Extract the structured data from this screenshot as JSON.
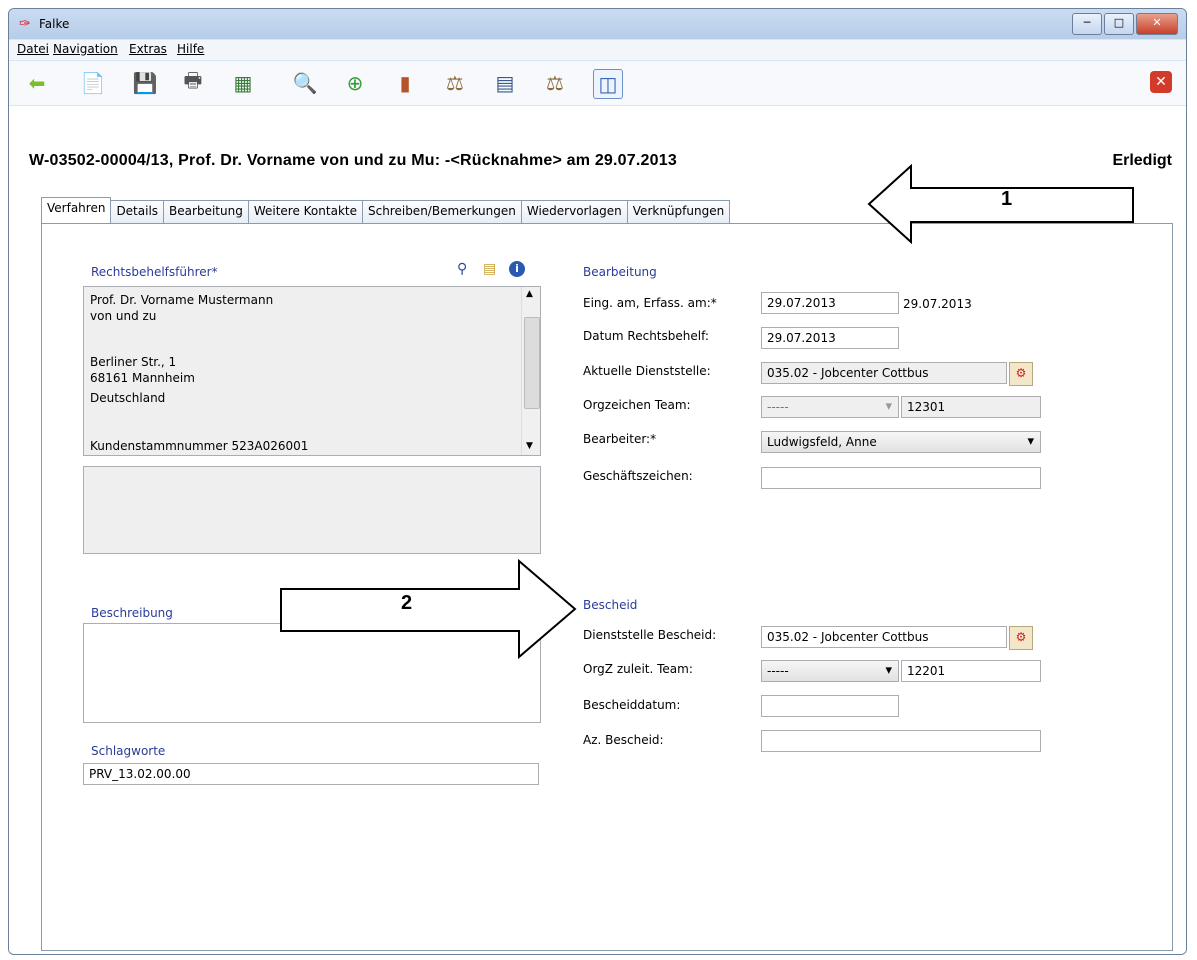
{
  "window": {
    "title": "Falke",
    "controls": [
      "─",
      "□",
      "✕"
    ]
  },
  "menu": [
    "Datei",
    "Navigation",
    "Extras",
    "Hilfe"
  ],
  "toolbar_icons": [
    "back-arrow-icon",
    "new-document-icon",
    "save-icon",
    "print-icon",
    "export-excel-icon",
    "search-icon",
    "search-add-icon",
    "folder-icon",
    "scales-gavel-icon",
    "ledger-icon",
    "scales-icon",
    "split-view-icon"
  ],
  "record": {
    "title": "W-03502-00004/13, Prof. Dr. Vorname von und zu Mu: -<Rücknahme> am 29.07.2013",
    "status": "Erledigt"
  },
  "tabs": [
    "Verfahren",
    "Details",
    "Bearbeitung",
    "Weitere Kontakte",
    "Schreiben/Bemerkungen",
    "Wiedervorlagen",
    "Verknüpfungen"
  ],
  "left": {
    "rb_title": "Rechtsbehelfsführer*",
    "address_lines": [
      "Prof. Dr. Vorname Mustermann",
      "von und zu",
      "",
      "Berliner Str., 1",
      "68161 Mannheim",
      "Deutschland",
      "",
      "Kundenstammnummer 523A026001"
    ],
    "beschreibung_title": "Beschreibung",
    "schlagworte_title": "Schlagworte",
    "schlagworte_value": "PRV_13.02.00.00"
  },
  "bearbeitung": {
    "title": "Bearbeitung",
    "eing_label": "Eing. am, Erfass. am:*",
    "eing_value": "29.07.2013",
    "erfass_value": "29.07.2013",
    "datum_label": "Datum Rechtsbehelf:",
    "datum_value": "29.07.2013",
    "dienst_label": "Aktuelle Dienststelle:",
    "dienst_value": "035.02 - Jobcenter Cottbus",
    "orgz_label": "Orgzeichen Team:",
    "orgz_value": "-----",
    "orgz_code": "12301",
    "bearbeiter_label": "Bearbeiter:*",
    "bearbeiter_value": "Ludwigsfeld, Anne",
    "gz_label": "Geschäftszeichen:"
  },
  "bescheid": {
    "title": "Bescheid",
    "dienst_label": "Dienststelle Bescheid:",
    "dienst_value": "035.02 - Jobcenter Cottbus",
    "orgz_label": "OrgZ zuleit. Team:",
    "orgz_value": "-----",
    "orgz_code": "12201",
    "datum_label": "Bescheiddatum:",
    "az_label": "Az. Bescheid:"
  },
  "annotations": {
    "arrow1": "1",
    "arrow2": "2"
  }
}
